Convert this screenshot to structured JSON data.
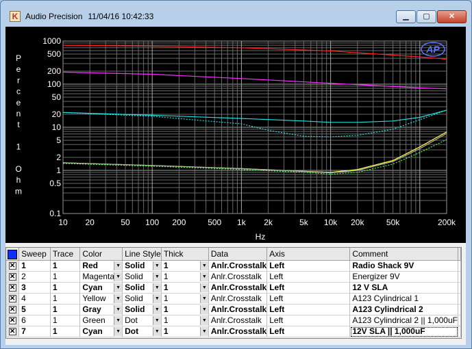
{
  "window": {
    "app_name": "Audio Precision",
    "timestamp": "11/04/16 10:42:33",
    "minimize": "▁",
    "maximize": "▢",
    "close": "✕"
  },
  "chart_data": {
    "type": "line",
    "logo": "AP",
    "ylabel": "Percent 1 Ohm",
    "xlabel": "Hz",
    "x_ticks": [
      "10",
      "20",
      "50",
      "100",
      "200",
      "500",
      "1k",
      "2k",
      "5k",
      "10k",
      "20k",
      "50k",
      "200k"
    ],
    "x_tick_values": [
      10,
      20,
      50,
      100,
      200,
      500,
      1000,
      2000,
      5000,
      10000,
      20000,
      50000,
      200000
    ],
    "y_ticks": [
      "1000",
      "500",
      "200",
      "100",
      "50",
      "20",
      "10",
      "5",
      "2",
      "1",
      "0.5",
      "0.1"
    ],
    "y_tick_values": [
      1000,
      500,
      200,
      100,
      50,
      20,
      10,
      5,
      2,
      1,
      0.5,
      0.1
    ],
    "x_scale": "log",
    "y_scale": "log",
    "xlim": [
      10,
      200000
    ],
    "ylim": [
      0.1,
      1000
    ],
    "grid": true,
    "series": [
      {
        "name": "Radio Shack 9V",
        "color": "#ff2020",
        "style": "solid",
        "x": [
          10,
          100,
          1000,
          10000,
          100000,
          200000
        ],
        "y": [
          800,
          760,
          700,
          590,
          430,
          380
        ]
      },
      {
        "name": "Energizer 9V",
        "color": "#ff30ff",
        "style": "solid",
        "x": [
          10,
          100,
          1000,
          10000,
          100000,
          200000
        ],
        "y": [
          190,
          170,
          135,
          105,
          82,
          78
        ]
      },
      {
        "name": "12 V SLA",
        "color": "#20e0e0",
        "style": "solid",
        "x": [
          10,
          100,
          1000,
          5000,
          10000,
          20000,
          50000,
          100000,
          200000
        ],
        "y": [
          22,
          19,
          16,
          14,
          13,
          13,
          14,
          17,
          25
        ]
      },
      {
        "name": "A123 Cylindrical 1",
        "color": "#ffff40",
        "style": "solid",
        "x": [
          10,
          100,
          1000,
          5000,
          10000,
          20000,
          50000,
          100000,
          200000
        ],
        "y": [
          1.5,
          1.3,
          1.1,
          0.95,
          0.9,
          1.05,
          1.7,
          3.5,
          7.8
        ]
      },
      {
        "name": "A123 Cylindrical 2",
        "color": "#b0b0b0",
        "style": "solid",
        "x": [
          10,
          100,
          1000,
          5000,
          10000,
          20000,
          50000,
          100000,
          200000
        ],
        "y": [
          1.5,
          1.3,
          1.1,
          0.95,
          0.88,
          1.0,
          1.6,
          3.2,
          7.2
        ]
      },
      {
        "name": "A123 Cylindrical 2 || 1,000uF",
        "color": "#40ff40",
        "style": "dot",
        "x": [
          10,
          100,
          1000,
          5000,
          10000,
          20000,
          50000,
          100000,
          200000
        ],
        "y": [
          1.45,
          1.25,
          1.05,
          0.9,
          0.82,
          0.9,
          1.4,
          2.6,
          5.2
        ]
      },
      {
        "name": "12V SLA || 1,000uF",
        "color": "#20e0e0",
        "style": "dot",
        "x": [
          10,
          100,
          1000,
          2000,
          5000,
          10000,
          20000,
          50000,
          100000,
          200000
        ],
        "y": [
          22,
          18,
          12,
          8.5,
          6.2,
          6.0,
          6.5,
          9,
          15,
          25
        ]
      }
    ]
  },
  "table": {
    "headers": [
      "Sweep",
      "Trace",
      "Color",
      "Line Style",
      "Thick",
      "Data",
      "Axis",
      "Comment"
    ],
    "rows": [
      {
        "bold": true,
        "sweep": "1",
        "trace": "1",
        "color": "Red",
        "style": "Solid",
        "thick": "1",
        "data": "Anlr.Crosstalk",
        "axis": "Left",
        "comment": "Radio Shack 9V"
      },
      {
        "bold": false,
        "sweep": "2",
        "trace": "1",
        "color": "Magenta",
        "style": "Solid",
        "thick": "1",
        "data": "Anlr.Crosstalk",
        "axis": "Left",
        "comment": "Energizer 9V"
      },
      {
        "bold": true,
        "sweep": "3",
        "trace": "1",
        "color": "Cyan",
        "style": "Solid",
        "thick": "1",
        "data": "Anlr.Crosstalk",
        "axis": "Left",
        "comment": "12 V SLA"
      },
      {
        "bold": false,
        "sweep": "4",
        "trace": "1",
        "color": "Yellow",
        "style": "Solid",
        "thick": "1",
        "data": "Anlr.Crosstalk",
        "axis": "Left",
        "comment": "A123 Cylindrical 1"
      },
      {
        "bold": true,
        "sweep": "5",
        "trace": "1",
        "color": "Gray",
        "style": "Solid",
        "thick": "1",
        "data": "Anlr.Crosstalk",
        "axis": "Left",
        "comment": "A123 Cylindrical 2"
      },
      {
        "bold": false,
        "sweep": "6",
        "trace": "1",
        "color": "Green",
        "style": "Dot",
        "thick": "1",
        "data": "Anlr.Crosstalk",
        "axis": "Left",
        "comment": "A123 Cylindrical 2 || 1,000uF"
      },
      {
        "bold": true,
        "sweep": "7",
        "trace": "1",
        "color": "Cyan",
        "style": "Dot",
        "thick": "1",
        "data": "Anlr.Crosstalk",
        "axis": "Left",
        "comment": "12V SLA || 1,000uF"
      }
    ]
  }
}
